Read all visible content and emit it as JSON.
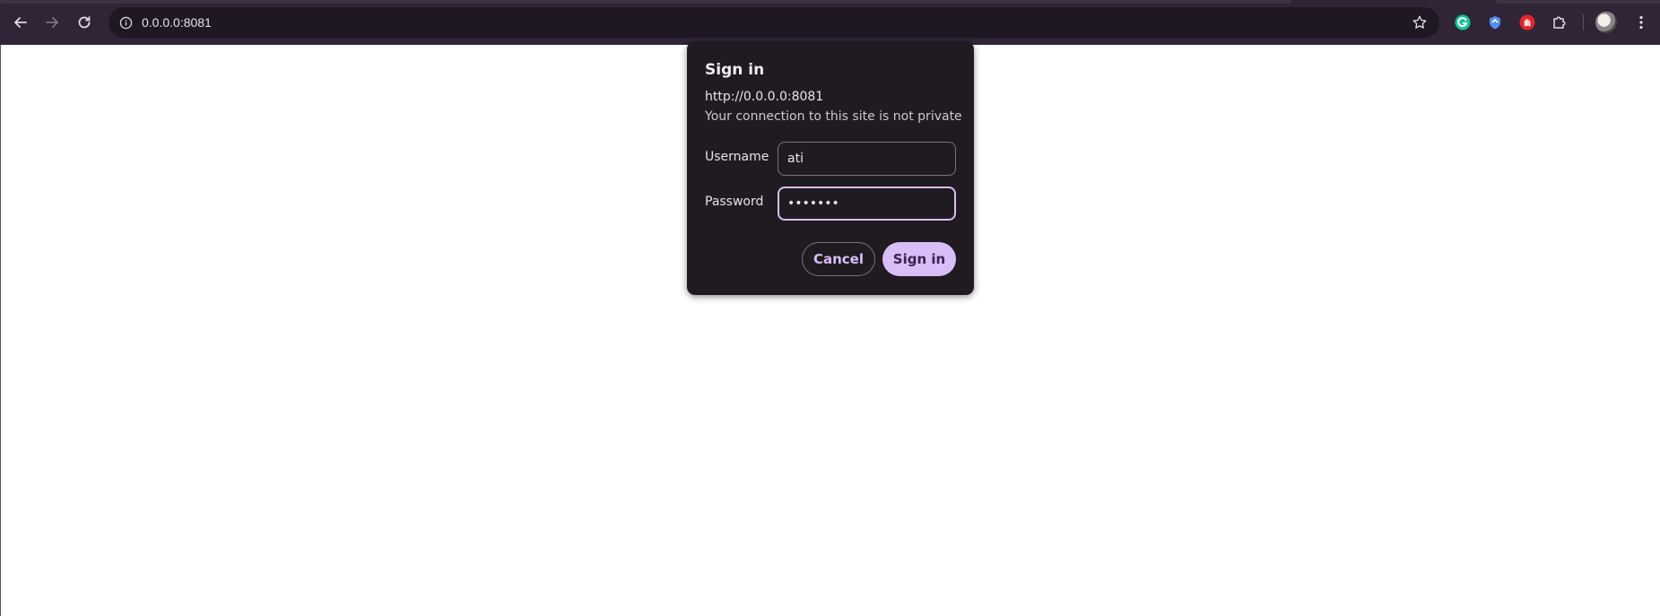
{
  "browser": {
    "url": "0.0.0.0:8081",
    "toolbar_color": "#302536",
    "extensions": [
      "grammarly-icon",
      "shield-extension-icon",
      "red-hand-extension-icon",
      "puzzle-extensions-icon"
    ]
  },
  "dialog": {
    "title": "Sign in",
    "origin": "http://0.0.0.0:8081",
    "warning": "Your connection to this site is not private",
    "username_label": "Username",
    "username_value": "ati",
    "password_label": "Password",
    "password_value": "•••••••",
    "cancel_label": "Cancel",
    "signin_label": "Sign in",
    "accent_color": "#d9bdf7"
  }
}
